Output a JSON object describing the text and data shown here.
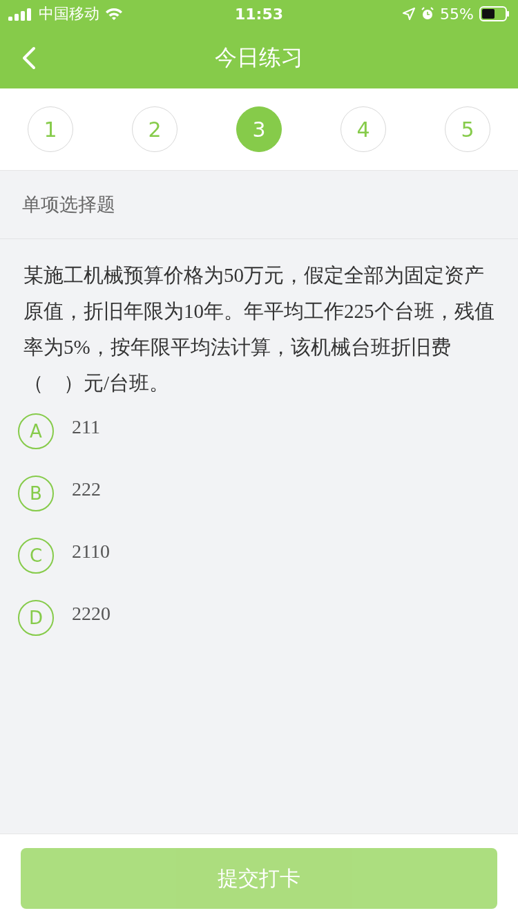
{
  "status_bar": {
    "carrier": "中国移动",
    "time": "11:53",
    "battery": "55%"
  },
  "nav": {
    "title": "今日练习"
  },
  "steps": [
    {
      "label": "1",
      "selected": false
    },
    {
      "label": "2",
      "selected": false
    },
    {
      "label": "3",
      "selected": true
    },
    {
      "label": "4",
      "selected": false
    },
    {
      "label": "5",
      "selected": false
    }
  ],
  "section": {
    "title": "单项选择题"
  },
  "question": {
    "text": "某施工机械预算价格为50万元，假定全部为固定资产原值，折旧年限为10年。年平均工作225个台班，残值率为5%，按年限平均法计算，该机械台班折旧费（　）元/台班。"
  },
  "options": [
    {
      "letter": "A",
      "text": "211",
      "selected": false
    },
    {
      "letter": "B",
      "text": "222",
      "selected": false
    },
    {
      "letter": "C",
      "text": "2110",
      "selected": false
    },
    {
      "letter": "D",
      "text": "2220",
      "selected": false
    }
  ],
  "submit": {
    "label": "提交打卡",
    "disabled": true
  }
}
